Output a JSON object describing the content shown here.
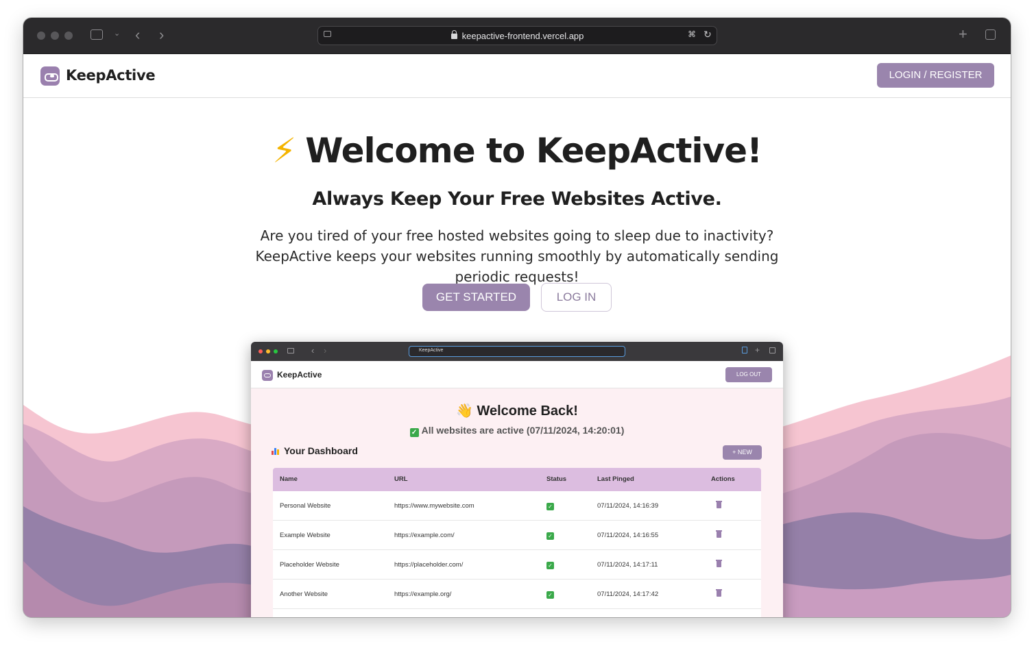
{
  "browser": {
    "url": "keepactive-frontend.vercel.app"
  },
  "nav": {
    "brand": "KeepActive",
    "login_register": "LOGIN / REGISTER"
  },
  "hero": {
    "icon": "⚡",
    "title": "Welcome to KeepActive!",
    "subtitle": "Always Keep Your Free Websites Active.",
    "description": "Are you tired of your free hosted websites going to sleep due to inactivity? KeepActive keeps your websites running smoothly by automatically sending periodic requests!",
    "get_started": "GET STARTED",
    "log_in": "LOG IN"
  },
  "preview": {
    "address": "KeepActive",
    "brand": "KeepActive",
    "logout": "LOG OUT",
    "welcome_icon": "👋",
    "welcome": "Welcome Back!",
    "status": "All websites are active (07/11/2024, 14:20:01)",
    "dashboard_title": "Your Dashboard",
    "new_button": "+ NEW",
    "columns": [
      "Name",
      "URL",
      "Status",
      "Last Pinged",
      "Actions"
    ],
    "rows": [
      {
        "name": "Personal Website",
        "url": "https://www.mywebsite.com",
        "status": "✓",
        "last_pinged": "07/11/2024, 14:16:39"
      },
      {
        "name": "Example Website",
        "url": "https://example.com/",
        "status": "✓",
        "last_pinged": "07/11/2024, 14:16:55"
      },
      {
        "name": "Placeholder Website",
        "url": "https://placeholder.com/",
        "status": "✓",
        "last_pinged": "07/11/2024, 14:17:11"
      },
      {
        "name": "Another Website",
        "url": "https://example.org/",
        "status": "✓",
        "last_pinged": "07/11/2024, 14:17:42"
      }
    ]
  },
  "colors": {
    "accent": "#9a85ad",
    "table_header": "#dcbde0",
    "wave_pink": "#f6c5d1",
    "wave_mauve": "#c59abb",
    "wave_purple": "#9580a8"
  }
}
